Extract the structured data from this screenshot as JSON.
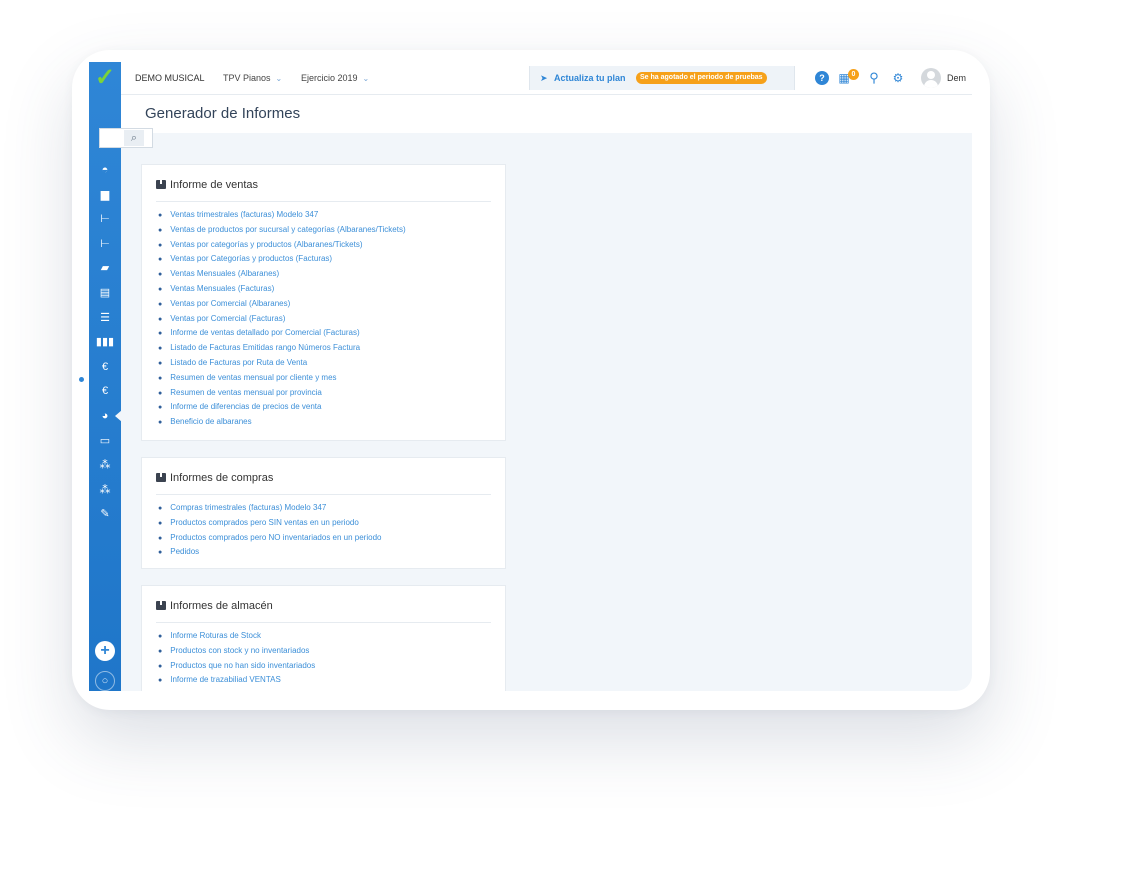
{
  "topbar": {
    "company": "DEMO MUSICAL",
    "store": "TPV Pianos",
    "year": "Ejercicio 2019",
    "chevron": "⌄",
    "plan_label": "Actualiza tu plan",
    "plan_badge": "Se ha agotado el periodo de pruebas",
    "notifications_count": "0",
    "user_name": "Dem"
  },
  "page": {
    "title": "Generador de Informes"
  },
  "sections": [
    {
      "title": "Informe de ventas",
      "items": [
        "Ventas trimestrales (facturas) Modelo 347",
        "Ventas de productos por sucursal y categorías (Albaranes/Tickets)",
        "Ventas por categorías y productos (Albaranes/Tickets)",
        "Ventas por Categorías y productos (Facturas)",
        "Ventas Mensuales (Albaranes)",
        "Ventas Mensuales (Facturas)",
        "Ventas por Comercial (Albaranes)",
        "Ventas por Comercial (Facturas)",
        "Informe de ventas detallado por Comercial (Facturas)",
        "Listado de Facturas Emitidas rango Números Factura",
        "Listado de Facturas por Ruta de Venta",
        "Resumen de ventas mensual por cliente y mes",
        "Resumen de ventas mensual por provincia",
        "Informe de diferencias de precios de venta",
        "Beneficio de albaranes"
      ]
    },
    {
      "title": "Informes de compras",
      "items": [
        "Compras trimestrales (facturas) Modelo 347",
        "Productos comprados pero SIN ventas en un periodo",
        "Productos comprados pero NO inventariados en un periodo",
        "Pedidos"
      ]
    },
    {
      "title": "Informes de almacén",
      "items": [
        "Informe Roturas de Stock",
        "Productos con stock y no inventariados",
        "Productos que no han sido inventariados",
        "Informe de trazabiliad VENTAS"
      ]
    }
  ],
  "sidebar": {
    "icons": [
      "dashboard-icon",
      "box-icon",
      "hierarchy-icon",
      "hierarchy-icon",
      "store-icon",
      "document-icon",
      "list-icon",
      "barcode-icon",
      "euro-icon",
      "euro-icon",
      "pie-chart-icon",
      "card-icon",
      "group-icon",
      "group-icon",
      "wrench-icon"
    ]
  },
  "colors": {
    "sidebar": "#2f86d6",
    "link": "#3c8fd8",
    "badge": "#f6a11a",
    "logo": "#7bd33a"
  }
}
